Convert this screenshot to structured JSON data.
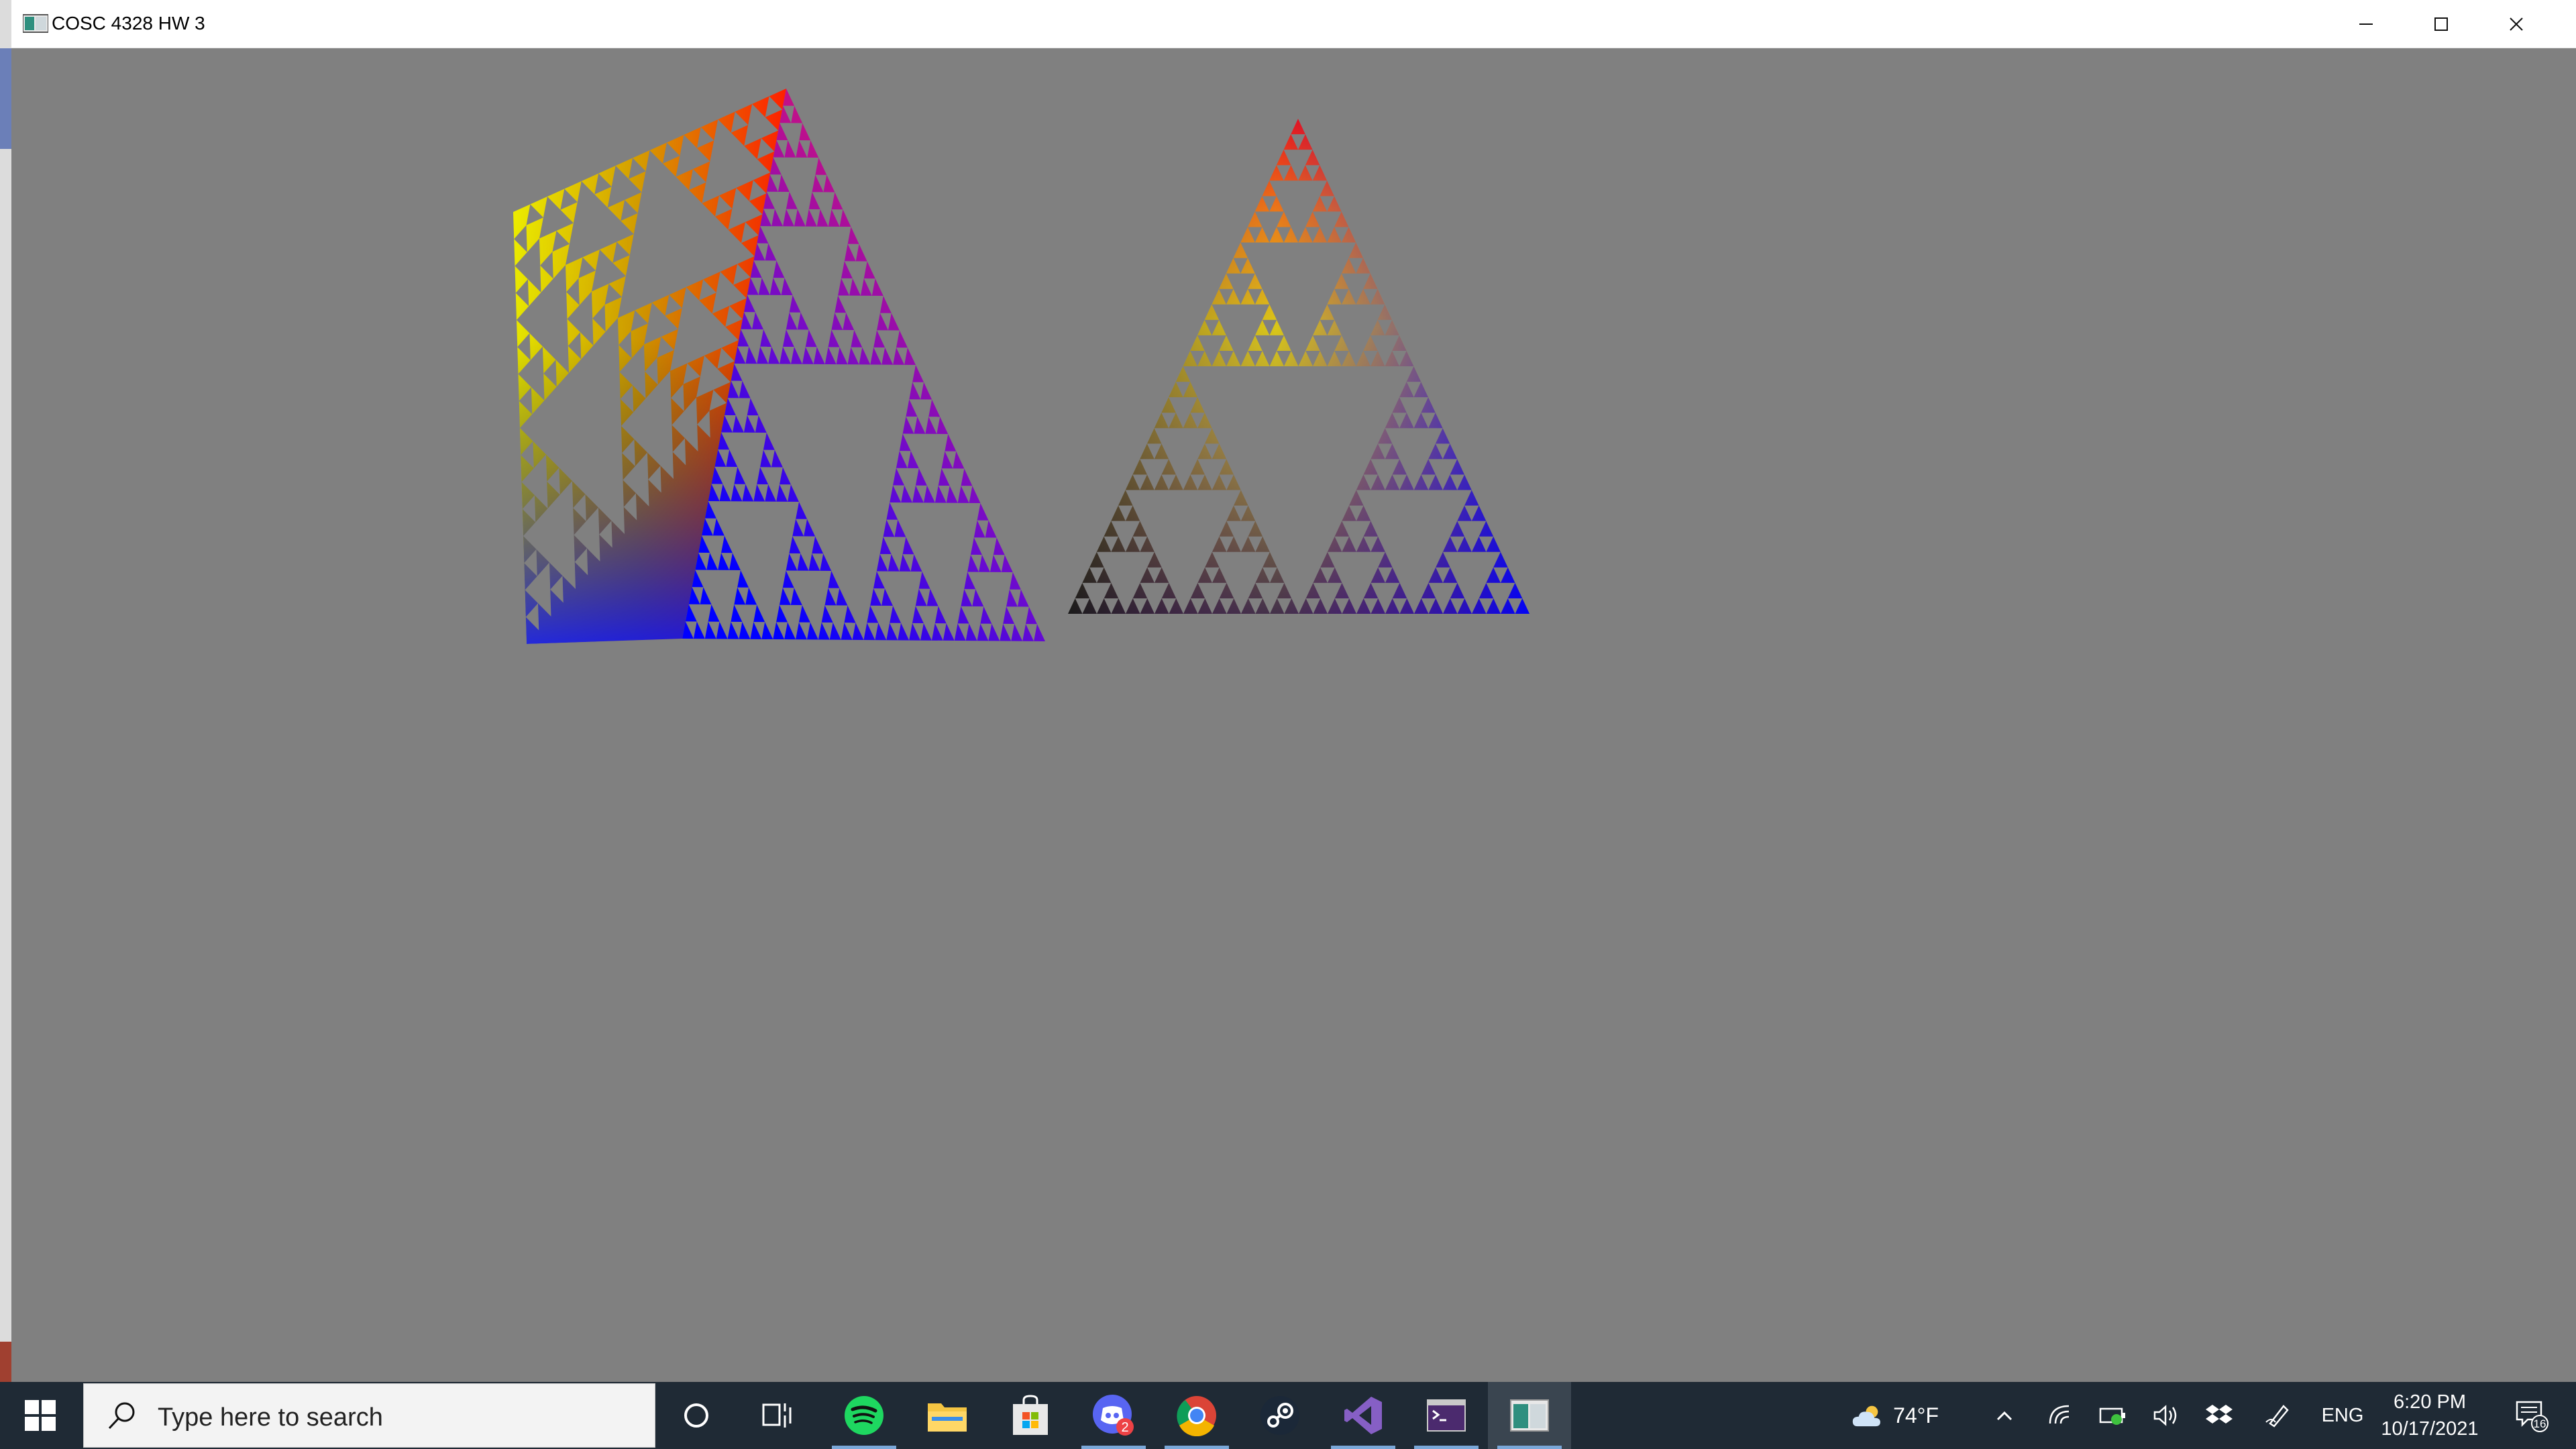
{
  "window": {
    "title": "COSC 4328 HW 3",
    "controls": [
      "minimize",
      "maximize",
      "close"
    ]
  },
  "scene": {
    "background_color": "#808080",
    "objects": [
      {
        "name": "3D Sierpinski tetrahedron (rotated)",
        "colors": [
          "#ff0000",
          "#ffff00",
          "#0000ff",
          "#000000"
        ]
      },
      {
        "name": "2D Sierpinski triangle",
        "colors": [
          "#ff0000",
          "#ffff00",
          "#0000ff",
          "#000000"
        ]
      }
    ]
  },
  "taskbar": {
    "search_placeholder": "Type here to search",
    "apps": [
      {
        "icon": "cortana-icon"
      },
      {
        "icon": "task-view-icon"
      },
      {
        "icon": "spotify-icon",
        "running": true
      },
      {
        "icon": "file-explorer-icon"
      },
      {
        "icon": "microsoft-store-icon"
      },
      {
        "icon": "discord-icon",
        "badge": "2",
        "running": true
      },
      {
        "icon": "chrome-icon",
        "running": true
      },
      {
        "icon": "steam-icon"
      },
      {
        "icon": "visual-studio-icon",
        "running": true
      },
      {
        "icon": "terminal-icon",
        "running": true
      },
      {
        "icon": "opengl-app-icon",
        "running": true,
        "active": true
      }
    ],
    "weather": {
      "temp": "74°F",
      "icon": "partly-cloudy-icon"
    },
    "tray": {
      "language": "ENG",
      "time": "6:20 PM",
      "date": "10/17/2021",
      "notifications": "16"
    }
  }
}
